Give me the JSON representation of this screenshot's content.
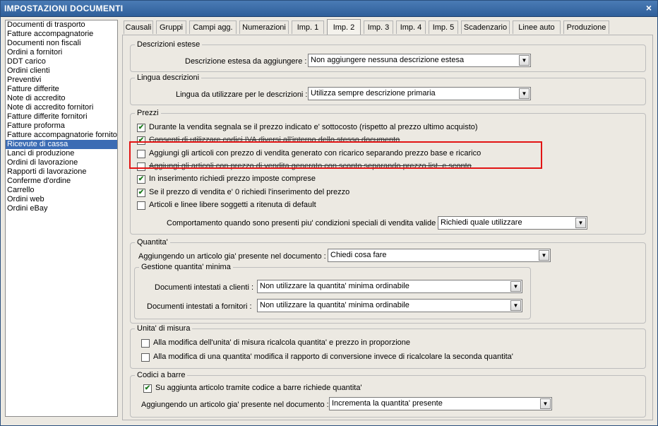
{
  "window": {
    "title": "IMPOSTAZIONI DOCUMENTI",
    "close_glyph": "×"
  },
  "sidebar": {
    "items": [
      "Documenti di trasporto",
      "Fatture accompagnatorie",
      "Documenti non fiscali",
      "Ordini a fornitori",
      "DDT carico",
      "Ordini clienti",
      "Preventivi",
      "Fatture differite",
      "Note di accredito",
      "Note di accredito fornitori",
      "Fatture differite fornitori",
      "Fatture proforma",
      "Fatture accompagnatorie fornito",
      "Ricevute di cassa",
      "Lanci di produzione",
      "Ordini di lavorazione",
      "Rapporti di lavorazione",
      "Conferme d'ordine",
      "Carrello",
      "Ordini web",
      "Ordini eBay"
    ],
    "selected": "Ricevute di cassa"
  },
  "tabs": [
    "Causali",
    "Gruppi",
    "Campi agg.",
    "Numerazioni",
    "Imp. 1",
    "Imp. 2",
    "Imp. 3",
    "Imp. 4",
    "Imp. 5",
    "Scadenzario",
    "Linee auto",
    "Produzione"
  ],
  "active_tab": "Imp. 2",
  "descrizioni": {
    "legend": "Descrizioni estese",
    "label": "Descrizione estesa da aggiungere :",
    "value": "Non aggiungere nessuna descrizione estesa"
  },
  "lingua": {
    "legend": "Lingua descrizioni",
    "label": "Lingua da utilizzare per le descrizioni :",
    "value": "Utilizza sempre descrizione primaria"
  },
  "prezzi": {
    "legend": "Prezzi",
    "options": [
      {
        "label": "Durante la vendita segnala se il prezzo indicato e' sottocosto (rispetto al prezzo ultimo acquisto)",
        "checked": true
      },
      {
        "label": "Consenti di utilizzare codici IVA diversi all'interno dello stesso documento",
        "checked": true
      },
      {
        "label": "Aggiungi gli articoli con prezzo di vendita generato con ricarico separando prezzo base e ricarico",
        "checked": false
      },
      {
        "label": "Aggiungi gli articoli con prezzo di vendita generato con sconto separando prezzo list. e sconto",
        "checked": false
      },
      {
        "label": "In inserimento richiedi prezzo imposte comprese",
        "checked": true
      },
      {
        "label": "Se il prezzo di vendita e' 0 richiedi l'inserimento del prezzo",
        "checked": true
      },
      {
        "label": "Articoli e linee libere soggetti a ritenuta di default",
        "checked": false
      }
    ],
    "condizioni_label": "Comportamento quando sono presenti piu' condizioni speciali di vendita valide :",
    "condizioni_value": "Richiedi quale utilizzare"
  },
  "quantita": {
    "legend": "Quantita'",
    "label": "Aggiungendo un articolo gia' presente nel documento :",
    "value": "Chiedi cosa fare",
    "minima": {
      "legend": "Gestione quantita' minima",
      "clienti_label": "Documenti intestati a clienti :",
      "clienti_value": "Non utilizzare la quantita' minima ordinabile",
      "fornitori_label": "Documenti intestati a fornitori :",
      "fornitori_value": "Non utilizzare la quantita' minima ordinabile"
    }
  },
  "unita": {
    "legend": "Unita' di misura",
    "options": [
      {
        "label": "Alla modifica dell'unita' di misura ricalcola quantita' e prezzo in proporzione",
        "checked": false
      },
      {
        "label": "Alla modifica di una quantita' modifica il rapporto di conversione invece di ricalcolare la seconda quantita'",
        "checked": false
      }
    ]
  },
  "codici": {
    "legend": "Codici a barre",
    "option": {
      "label": "Su aggiunta articolo tramite codice a barre richiede quantita'",
      "checked": true
    },
    "label": "Aggiungendo un articolo gia' presente nel documento :",
    "value": "Incrementa la quantita' presente"
  },
  "icons": {
    "check": "✔",
    "dropdown": "▼"
  },
  "colors": {
    "title_bar": "#2f5f9a",
    "selection": "#3c6cb4",
    "highlight": "#e21414",
    "check": "#1a7a1a"
  }
}
